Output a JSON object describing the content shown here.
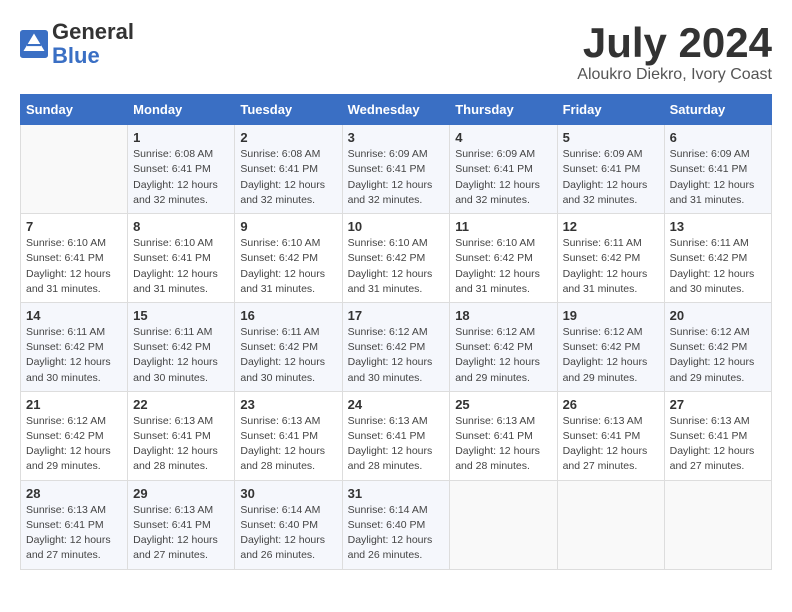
{
  "header": {
    "logo_general": "General",
    "logo_blue": "Blue",
    "month_title": "July 2024",
    "location": "Aloukro Diekro, Ivory Coast"
  },
  "weekdays": [
    "Sunday",
    "Monday",
    "Tuesday",
    "Wednesday",
    "Thursday",
    "Friday",
    "Saturday"
  ],
  "weeks": [
    [
      {
        "day": "",
        "info": ""
      },
      {
        "day": "1",
        "info": "Sunrise: 6:08 AM\nSunset: 6:41 PM\nDaylight: 12 hours\nand 32 minutes."
      },
      {
        "day": "2",
        "info": "Sunrise: 6:08 AM\nSunset: 6:41 PM\nDaylight: 12 hours\nand 32 minutes."
      },
      {
        "day": "3",
        "info": "Sunrise: 6:09 AM\nSunset: 6:41 PM\nDaylight: 12 hours\nand 32 minutes."
      },
      {
        "day": "4",
        "info": "Sunrise: 6:09 AM\nSunset: 6:41 PM\nDaylight: 12 hours\nand 32 minutes."
      },
      {
        "day": "5",
        "info": "Sunrise: 6:09 AM\nSunset: 6:41 PM\nDaylight: 12 hours\nand 32 minutes."
      },
      {
        "day": "6",
        "info": "Sunrise: 6:09 AM\nSunset: 6:41 PM\nDaylight: 12 hours\nand 31 minutes."
      }
    ],
    [
      {
        "day": "7",
        "info": ""
      },
      {
        "day": "8",
        "info": "Sunrise: 6:10 AM\nSunset: 6:41 PM\nDaylight: 12 hours\nand 31 minutes."
      },
      {
        "day": "9",
        "info": "Sunrise: 6:10 AM\nSunset: 6:42 PM\nDaylight: 12 hours\nand 31 minutes."
      },
      {
        "day": "10",
        "info": "Sunrise: 6:10 AM\nSunset: 6:42 PM\nDaylight: 12 hours\nand 31 minutes."
      },
      {
        "day": "11",
        "info": "Sunrise: 6:10 AM\nSunset: 6:42 PM\nDaylight: 12 hours\nand 31 minutes."
      },
      {
        "day": "12",
        "info": "Sunrise: 6:11 AM\nSunset: 6:42 PM\nDaylight: 12 hours\nand 31 minutes."
      },
      {
        "day": "13",
        "info": "Sunrise: 6:11 AM\nSunset: 6:42 PM\nDaylight: 12 hours\nand 30 minutes."
      }
    ],
    [
      {
        "day": "14",
        "info": ""
      },
      {
        "day": "15",
        "info": "Sunrise: 6:11 AM\nSunset: 6:42 PM\nDaylight: 12 hours\nand 30 minutes."
      },
      {
        "day": "16",
        "info": "Sunrise: 6:11 AM\nSunset: 6:42 PM\nDaylight: 12 hours\nand 30 minutes."
      },
      {
        "day": "17",
        "info": "Sunrise: 6:12 AM\nSunset: 6:42 PM\nDaylight: 12 hours\nand 30 minutes."
      },
      {
        "day": "18",
        "info": "Sunrise: 6:12 AM\nSunset: 6:42 PM\nDaylight: 12 hours\nand 29 minutes."
      },
      {
        "day": "19",
        "info": "Sunrise: 6:12 AM\nSunset: 6:42 PM\nDaylight: 12 hours\nand 29 minutes."
      },
      {
        "day": "20",
        "info": "Sunrise: 6:12 AM\nSunset: 6:42 PM\nDaylight: 12 hours\nand 29 minutes."
      }
    ],
    [
      {
        "day": "21",
        "info": ""
      },
      {
        "day": "22",
        "info": "Sunrise: 6:13 AM\nSunset: 6:41 PM\nDaylight: 12 hours\nand 28 minutes."
      },
      {
        "day": "23",
        "info": "Sunrise: 6:13 AM\nSunset: 6:41 PM\nDaylight: 12 hours\nand 28 minutes."
      },
      {
        "day": "24",
        "info": "Sunrise: 6:13 AM\nSunset: 6:41 PM\nDaylight: 12 hours\nand 28 minutes."
      },
      {
        "day": "25",
        "info": "Sunrise: 6:13 AM\nSunset: 6:41 PM\nDaylight: 12 hours\nand 28 minutes."
      },
      {
        "day": "26",
        "info": "Sunrise: 6:13 AM\nSunset: 6:41 PM\nDaylight: 12 hours\nand 27 minutes."
      },
      {
        "day": "27",
        "info": "Sunrise: 6:13 AM\nSunset: 6:41 PM\nDaylight: 12 hours\nand 27 minutes."
      }
    ],
    [
      {
        "day": "28",
        "info": "Sunrise: 6:13 AM\nSunset: 6:41 PM\nDaylight: 12 hours\nand 27 minutes."
      },
      {
        "day": "29",
        "info": "Sunrise: 6:13 AM\nSunset: 6:41 PM\nDaylight: 12 hours\nand 27 minutes."
      },
      {
        "day": "30",
        "info": "Sunrise: 6:14 AM\nSunset: 6:40 PM\nDaylight: 12 hours\nand 26 minutes."
      },
      {
        "day": "31",
        "info": "Sunrise: 6:14 AM\nSunset: 6:40 PM\nDaylight: 12 hours\nand 26 minutes."
      },
      {
        "day": "",
        "info": ""
      },
      {
        "day": "",
        "info": ""
      },
      {
        "day": "",
        "info": ""
      }
    ]
  ],
  "week1_day7_info": "Sunrise: 6:10 AM\nSunset: 6:41 PM\nDaylight: 12 hours\nand 31 minutes.",
  "week3_day14_info": "Sunrise: 6:11 AM\nSunset: 6:42 PM\nDaylight: 12 hours\nand 30 minutes.",
  "week4_day21_info": "Sunrise: 6:12 AM\nSunset: 6:42 PM\nDaylight: 12 hours\nand 29 minutes."
}
